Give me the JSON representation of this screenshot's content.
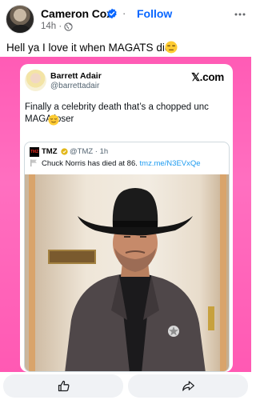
{
  "post": {
    "author": "Cameron Cox",
    "separator": "·",
    "follow_label": "Follow",
    "time": "14h ·",
    "caption": "Hell ya I love it when MAGATS die"
  },
  "tweet": {
    "name": "Barrett Adair",
    "handle": "@barrettadair",
    "logo": "𝕏.com",
    "text": "Finally a celebrity death that’s a chopped unc MAGA loser"
  },
  "quoted": {
    "logo_text": "TMZ",
    "name": "TMZ",
    "handle": "@TMZ · 1h",
    "text": "Chuck Norris has died at 86.",
    "link": "tmz.me/N3EVxQe"
  },
  "colors": {
    "accent": "#0866ff",
    "background_pink": "#ff5bb5"
  },
  "icons": {
    "verified": "verified-badge-icon",
    "globe": "globe-icon",
    "more": "more-options-icon",
    "emoji": "unamused-face-emoji"
  }
}
